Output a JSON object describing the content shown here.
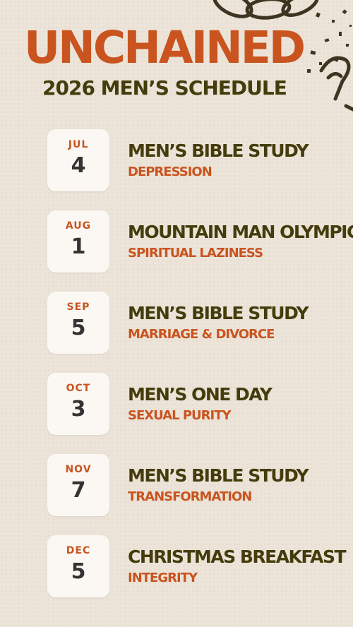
{
  "header": {
    "title": "UNCHAINED",
    "subtitle": "2026 MEN’S SCHEDULE"
  },
  "colors": {
    "background": "#ece4d8",
    "accent_orange": "#c9541f",
    "dark_olive": "#453c0d",
    "card": "#fbf8f4"
  },
  "decoration": {
    "icon": "broken-chain-icon"
  },
  "events": [
    {
      "month": "JUL",
      "day": "4",
      "title": "MEN’S BIBLE STUDY",
      "topic": "DEPRESSION"
    },
    {
      "month": "AUG",
      "day": "1",
      "title": "MOUNTAIN MAN OLYMPICS",
      "topic": "SPIRITUAL LAZINESS"
    },
    {
      "month": "SEP",
      "day": "5",
      "title": "MEN’S BIBLE STUDY",
      "topic": "MARRIAGE & DIVORCE"
    },
    {
      "month": "OCT",
      "day": "3",
      "title": "MEN’S ONE DAY",
      "topic": "SEXUAL PURITY"
    },
    {
      "month": "NOV",
      "day": "7",
      "title": "MEN’S BIBLE STUDY",
      "topic": "TRANSFORMATION"
    },
    {
      "month": "DEC",
      "day": "5",
      "title": "CHRISTMAS BREAKFAST",
      "topic": "INTEGRITY"
    }
  ]
}
